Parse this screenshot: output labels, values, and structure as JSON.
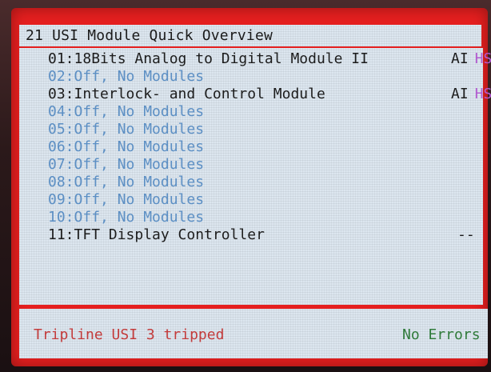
{
  "title": "21 USI Module Quick Overview",
  "modules": [
    {
      "num": "01:",
      "label": "18Bits Analog to Digital Module II",
      "ai": "AI",
      "hs": "HS",
      "dash": ""
    },
    {
      "num": "02:",
      "label": "Off, No Modules",
      "ai": "",
      "hs": "",
      "dash": ""
    },
    {
      "num": "03:",
      "label": "Interlock- and Control Module",
      "ai": "AI",
      "hs": "HS",
      "dash": ""
    },
    {
      "num": "04:",
      "label": "Off, No Modules",
      "ai": "",
      "hs": "",
      "dash": ""
    },
    {
      "num": "05:",
      "label": "Off, No Modules",
      "ai": "",
      "hs": "",
      "dash": ""
    },
    {
      "num": "06:",
      "label": "Off, No Modules",
      "ai": "",
      "hs": "",
      "dash": ""
    },
    {
      "num": "07:",
      "label": "Off, No Modules",
      "ai": "",
      "hs": "",
      "dash": ""
    },
    {
      "num": "08:",
      "label": "Off, No Modules",
      "ai": "",
      "hs": "",
      "dash": ""
    },
    {
      "num": "09:",
      "label": "Off, No Modules",
      "ai": "",
      "hs": "",
      "dash": ""
    },
    {
      "num": "10:",
      "label": "Off, No Modules",
      "ai": "",
      "hs": "",
      "dash": ""
    },
    {
      "num": "11:",
      "label": "TFT Display Controller",
      "ai": "",
      "hs": "",
      "dash": "--"
    }
  ],
  "status": {
    "message": "Tripline USI 3 tripped",
    "errors": "No Errors"
  },
  "colors": {
    "frame": "#e51f1f",
    "panel": "#dce6ef",
    "active_text": "#1c1c1c",
    "off_text": "#5c8fc4",
    "hs_flag": "#b25ad0",
    "status_alert": "#c33b3b",
    "status_ok": "#2f7a3a"
  }
}
